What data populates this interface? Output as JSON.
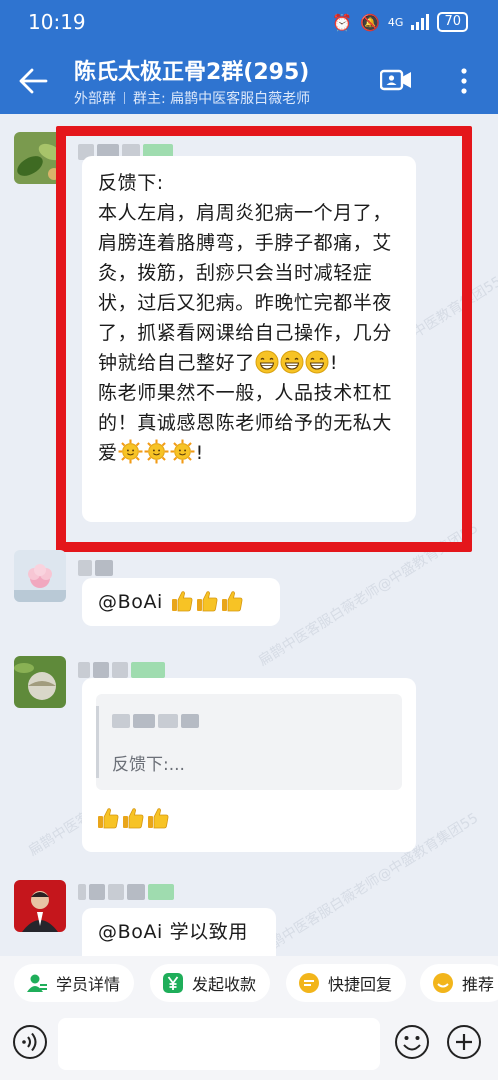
{
  "status_bar": {
    "time": "10:19",
    "network": "4G",
    "battery": "70"
  },
  "header": {
    "title": "陈氏太极正骨2群(295)",
    "external_label": "外部群",
    "owner": "群主: 扁鹊中医客服白薇老师"
  },
  "watermark_texts": [
    "扁鹊中医客服白薇老师@中盛教育集团55",
    "扁鹊中医教育集团55"
  ],
  "messages": [
    {
      "type": "text",
      "text": "反馈下:\n本人左肩，肩周炎犯病一个月了，肩膀连着胳膊弯，手脖子都痛，艾灸，拨筋，刮痧只会当时减轻症状，过后又犯病。昨晚忙完都半夜了，抓紧看网课给自己操作，几分钟就给自己整好了",
      "text_after_emoji": "!\n陈老师果然不一般，人品技术杠杠的！真诚感恩陈老师给予的无私大爱",
      "text_end": "!",
      "emoji_1": "grinning-face",
      "emoji_2": "sun-face"
    },
    {
      "type": "text",
      "text": "@BoAi ",
      "emoji": "thumbs-up"
    },
    {
      "type": "reply",
      "quoted_text": "反馈下:...",
      "emoji": "thumbs-up"
    },
    {
      "type": "text",
      "text": "@BoAi 学以致用"
    }
  ],
  "quick_actions": [
    {
      "label": "学员详情",
      "icon": "student-icon",
      "color": "#1fae5a"
    },
    {
      "label": "发起收款",
      "icon": "yen-icon",
      "color": "#1fae5a"
    },
    {
      "label": "快捷回复",
      "icon": "quick-reply-icon",
      "color": "#f2b51b"
    },
    {
      "label": "推荐",
      "icon": "recommend-icon",
      "color": "#f2b51b"
    }
  ],
  "input": {
    "placeholder": ""
  },
  "colors": {
    "header": "#2f74d0",
    "highlight": "#e4161b",
    "chat_bg": "#eaeef5"
  }
}
